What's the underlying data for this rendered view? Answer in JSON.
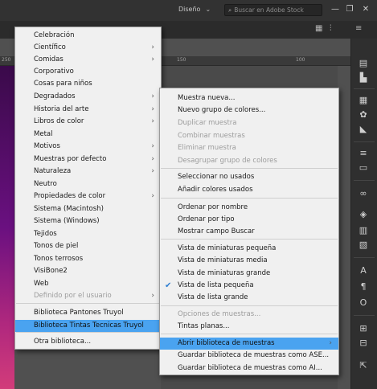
{
  "window": {
    "workspace_label": "Diseño",
    "search_placeholder": "Buscar en Adobe Stock",
    "min_glyph": "—",
    "restore_glyph": "❐",
    "close_glyph": "✕"
  },
  "ruler": {
    "ticks": [
      "250",
      "150",
      "100"
    ]
  },
  "library_menu": {
    "items": [
      {
        "label": "Celebración",
        "submenu": false
      },
      {
        "label": "Científico",
        "submenu": true
      },
      {
        "label": "Comidas",
        "submenu": true
      },
      {
        "label": "Corporativo",
        "submenu": false
      },
      {
        "label": "Cosas para niños",
        "submenu": false
      },
      {
        "label": "Degradados",
        "submenu": true
      },
      {
        "label": "Historia del arte",
        "submenu": true
      },
      {
        "label": "Libros de color",
        "submenu": true
      },
      {
        "label": "Metal",
        "submenu": false
      },
      {
        "label": "Motivos",
        "submenu": true
      },
      {
        "label": "Muestras por defecto",
        "submenu": true
      },
      {
        "label": "Naturaleza",
        "submenu": true
      },
      {
        "label": "Neutro",
        "submenu": false
      },
      {
        "label": "Propiedades de color",
        "submenu": true
      },
      {
        "label": "Sistema (Macintosh)",
        "submenu": false
      },
      {
        "label": "Sistema (Windows)",
        "submenu": false
      },
      {
        "label": "Tejidos",
        "submenu": false
      },
      {
        "label": "Tonos de piel",
        "submenu": false
      },
      {
        "label": "Tonos terrosos",
        "submenu": false
      },
      {
        "label": "VisiBone2",
        "submenu": false
      },
      {
        "label": "Web",
        "submenu": false
      },
      {
        "label": "Definido por el usuario",
        "submenu": true,
        "disabled": true
      },
      {
        "label": "Biblioteca Pantones Truyol",
        "submenu": false
      },
      {
        "label": "Biblioteca Tintas Tecnicas Truyol",
        "submenu": false,
        "highlighted": true
      },
      {
        "label": "Otra biblioteca...",
        "submenu": false
      }
    ]
  },
  "swatches_menu": {
    "items": [
      {
        "label": "Muestra nueva..."
      },
      {
        "label": "Nuevo grupo de colores..."
      },
      {
        "label": "Duplicar muestra",
        "disabled": true
      },
      {
        "label": "Combinar muestras",
        "disabled": true
      },
      {
        "label": "Eliminar muestra",
        "disabled": true
      },
      {
        "label": "Desagrupar grupo de colores",
        "disabled": true
      },
      {
        "label": "Seleccionar no usados"
      },
      {
        "label": "Añadir colores usados"
      },
      {
        "label": "Ordenar por nombre"
      },
      {
        "label": "Ordenar por tipo"
      },
      {
        "label": "Mostrar campo Buscar"
      },
      {
        "label": "Vista de miniaturas pequeña"
      },
      {
        "label": "Vista de miniaturas media"
      },
      {
        "label": "Vista de miniaturas grande"
      },
      {
        "label": "Vista de lista pequeña",
        "checked": true
      },
      {
        "label": "Vista de lista grande"
      },
      {
        "label": "Opciones de muestras...",
        "disabled": true
      },
      {
        "label": "Tintas planas..."
      },
      {
        "label": "Abrir biblioteca de muestras",
        "submenu": true,
        "highlighted": true
      },
      {
        "label": "Guardar biblioteca de muestras como ASE..."
      },
      {
        "label": "Guardar biblioteca de muestras como AI..."
      }
    ]
  },
  "icons": {
    "chevron": "›",
    "check": "✔",
    "dropdown": "⌄",
    "search": "⌕"
  }
}
